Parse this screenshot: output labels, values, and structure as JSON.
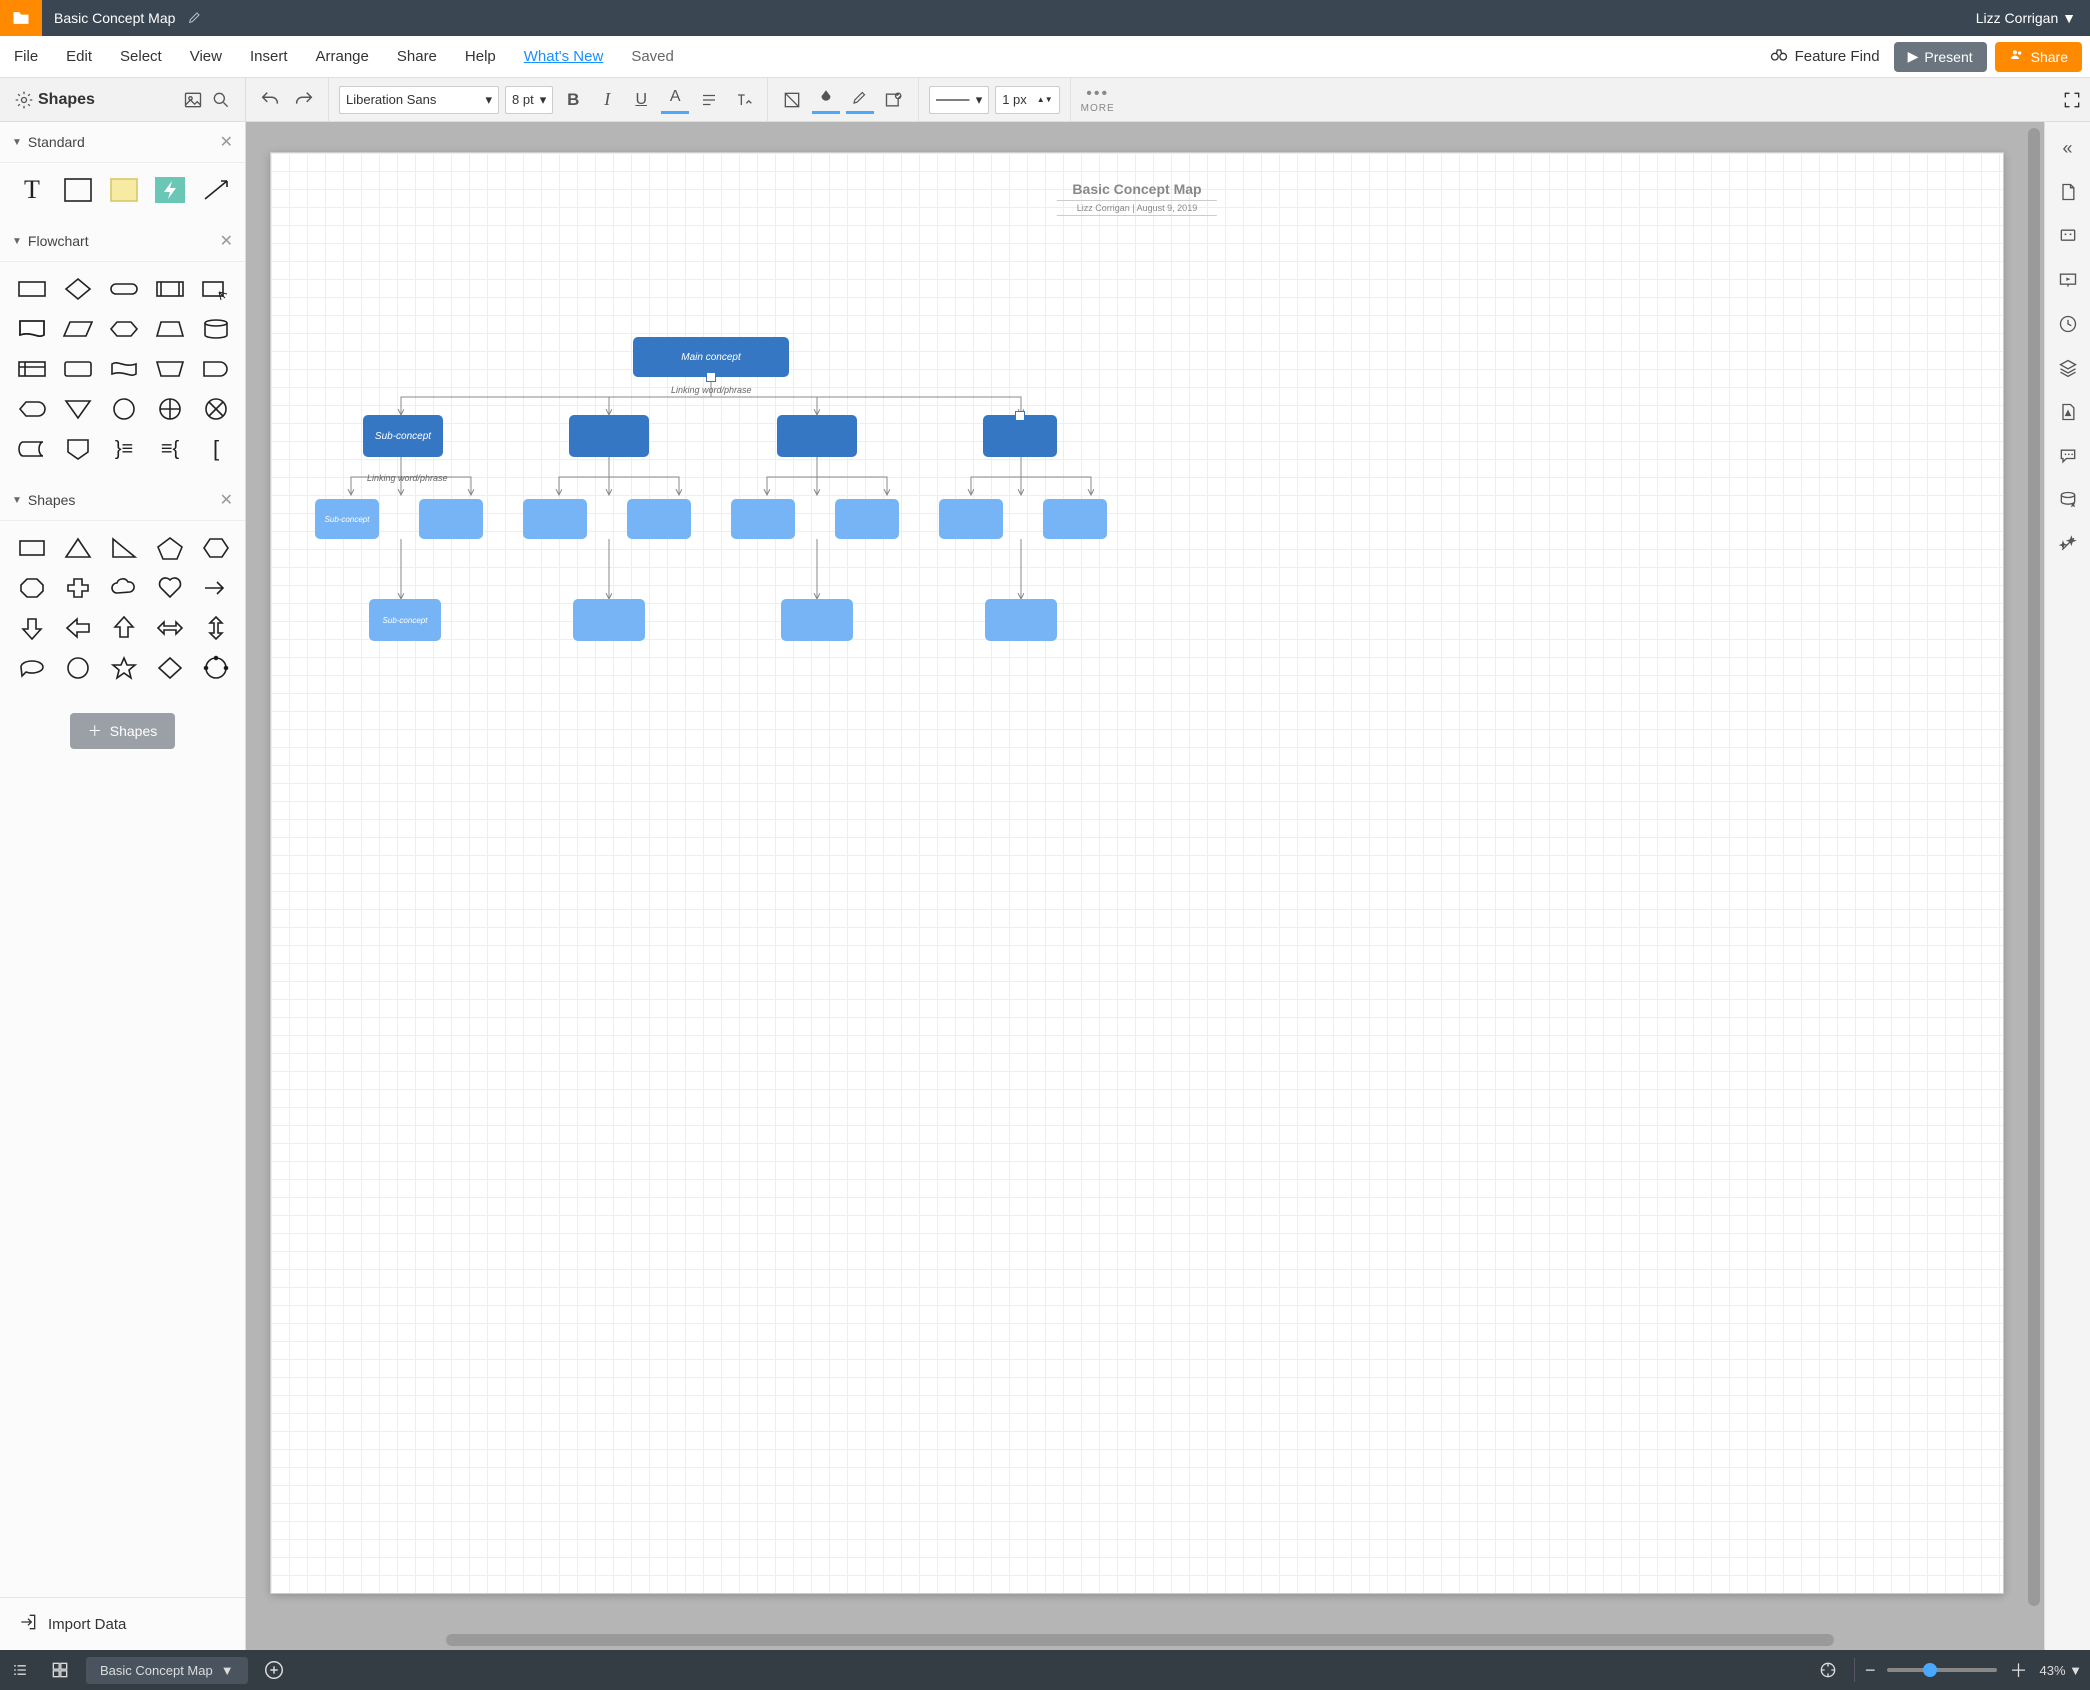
{
  "titlebar": {
    "doc_name": "Basic Concept Map",
    "user_name": "Lizz Corrigan"
  },
  "menubar": {
    "items": [
      "File",
      "Edit",
      "Select",
      "View",
      "Insert",
      "Arrange",
      "Share",
      "Help"
    ],
    "whats_new": "What's New",
    "saved": "Saved",
    "feature_find": "Feature Find",
    "present": "Present",
    "share": "Share"
  },
  "toolbar": {
    "shapes_label": "Shapes",
    "font_family": "Liberation Sans",
    "font_size": "8 pt",
    "line_width": "1 px",
    "more_label": "MORE"
  },
  "sidebar": {
    "sections": {
      "standard": "Standard",
      "flowchart": "Flowchart",
      "shapes": "Shapes"
    },
    "add_shapes": "Shapes",
    "import_label": "Import Data"
  },
  "canvas": {
    "title": "Basic Concept Map",
    "subtitle": "Lizz Corrigan  |  August 9, 2019",
    "main_concept": "Main concept",
    "linking_phrase": "Linking word/phrase",
    "sub_concept_a": "Sub-concept",
    "linking_phrase_2": "Linking word/phrase",
    "sub_concept_b": "Sub-concept",
    "sub_concept_c": "Sub-concept"
  },
  "bottombar": {
    "tab_name": "Basic Concept Map",
    "zoom_value": "43%"
  }
}
